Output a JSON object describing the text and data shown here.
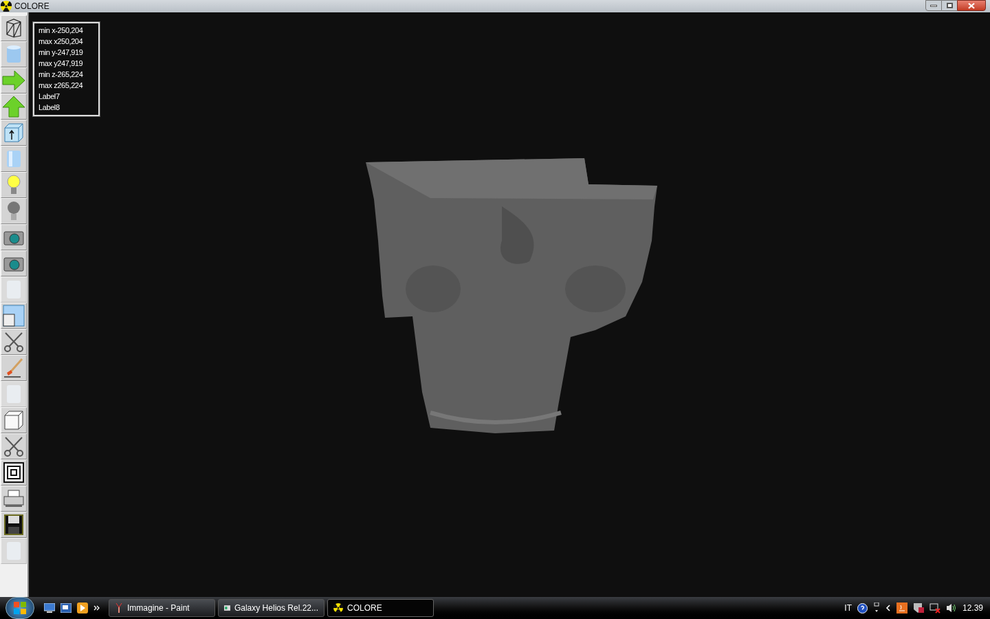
{
  "window": {
    "title": "COLORE"
  },
  "toolbar": [
    {
      "disabled": false
    },
    {
      "disabled": false
    },
    {
      "disabled": false
    },
    {
      "disabled": false
    },
    {
      "disabled": false
    },
    {
      "disabled": false
    },
    {
      "disabled": false
    },
    {
      "disabled": false
    },
    {
      "disabled": false
    },
    {
      "disabled": false
    },
    {
      "disabled": true
    },
    {
      "disabled": false
    },
    {
      "disabled": false
    },
    {
      "disabled": false
    },
    {
      "disabled": true
    },
    {
      "disabled": false
    },
    {
      "disabled": false
    },
    {
      "disabled": false
    },
    {
      "disabled": false
    },
    {
      "disabled": false
    },
    {
      "disabled": true
    }
  ],
  "info_labels": [
    "min x-250,204",
    "max x250,204",
    "min y-247,919",
    "max y247,919",
    "min z-265,224",
    "max z265,224",
    "Label7",
    "Label8"
  ],
  "taskbar": {
    "tasks": [
      {
        "label": "Immagine - Paint",
        "selected": false
      },
      {
        "label": "Galaxy Helios  Rel.22...",
        "selected": false
      },
      {
        "label": "COLORE",
        "selected": true
      }
    ],
    "language": "IT",
    "clock": "12.39"
  }
}
